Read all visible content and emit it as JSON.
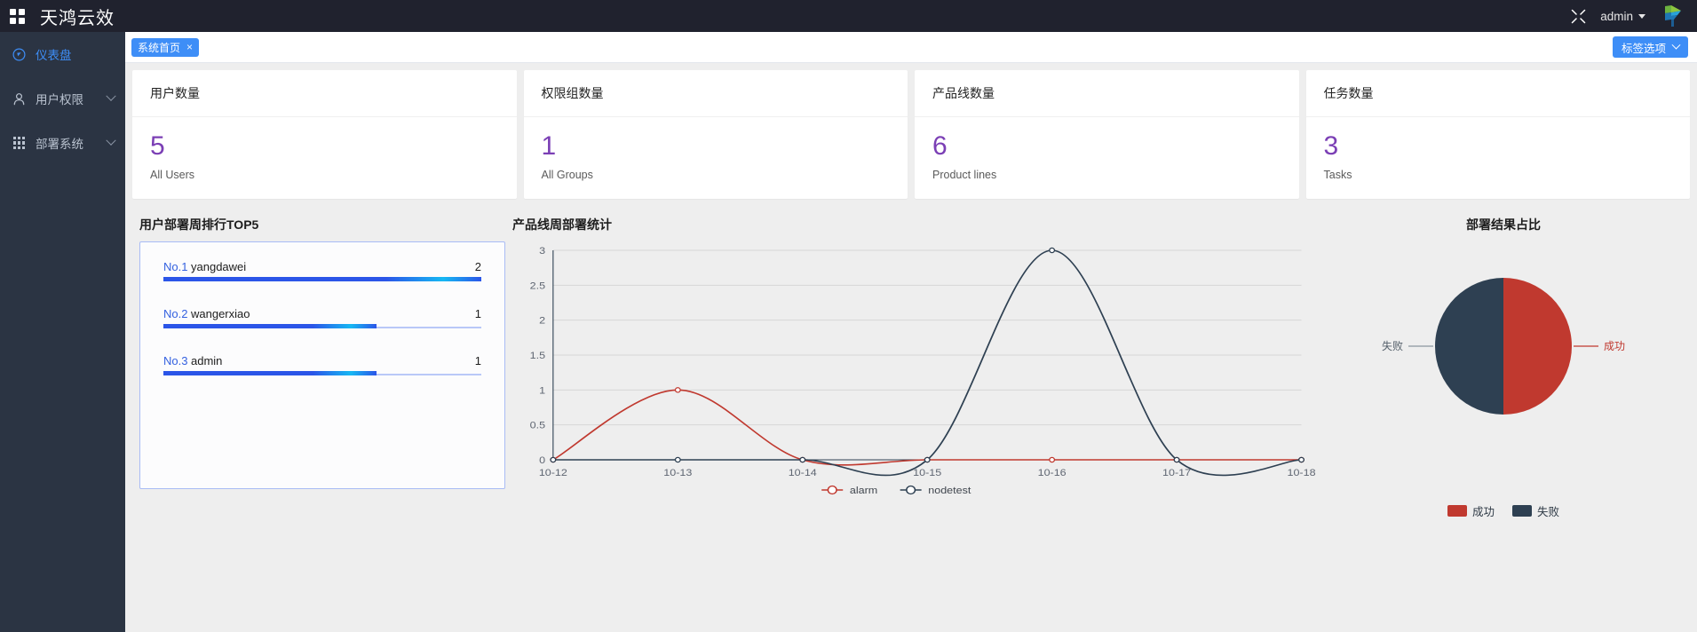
{
  "header": {
    "brand": "天鸿云效",
    "grid_icon": "grid-icon",
    "fullscreen_icon": "fullscreen-icon",
    "user": "admin",
    "logo_icon": "brand-logo-icon"
  },
  "sidebar": {
    "items": [
      {
        "label": "仪表盘",
        "icon": "dashboard-icon",
        "active": true,
        "expandable": false
      },
      {
        "label": "用户权限",
        "icon": "user-icon",
        "active": false,
        "expandable": true
      },
      {
        "label": "部署系统",
        "icon": "apps-grid-icon",
        "active": false,
        "expandable": true
      }
    ]
  },
  "tabbar": {
    "tabs": [
      {
        "label": "系统首页",
        "close": "×"
      }
    ],
    "tag_options_label": "标签选项"
  },
  "cards": [
    {
      "title": "用户数量",
      "value": "5",
      "subtitle": "All Users"
    },
    {
      "title": "权限组数量",
      "value": "1",
      "subtitle": "All Groups"
    },
    {
      "title": "产品线数量",
      "value": "6",
      "subtitle": "Product lines"
    },
    {
      "title": "任务数量",
      "value": "3",
      "subtitle": "Tasks"
    }
  ],
  "rank_panel": {
    "title": "用户部署周排行TOP5",
    "rows": [
      {
        "rank": "No.1",
        "name": "yangdawei",
        "value": "2",
        "pct": 100
      },
      {
        "rank": "No.2",
        "name": "wangerxiao",
        "value": "1",
        "pct": 67
      },
      {
        "rank": "No.3",
        "name": "admin",
        "value": "1",
        "pct": 67
      }
    ]
  },
  "colors": {
    "accent": "#3e8ef7",
    "rank_bar": "#2b55e8",
    "stat_number": "#7b3fb5",
    "series_alarm": "#c0392f",
    "series_nodetest": "#2e4052",
    "pie_success": "#c0392f",
    "pie_fail": "#2e4052",
    "sidebar_bg": "#2b3443",
    "header_bg": "#20222e"
  },
  "chart_data": [
    {
      "type": "line",
      "title": "产品线周部署统计",
      "xlabel": "",
      "ylabel": "",
      "x": [
        "10-12",
        "10-13",
        "10-14",
        "10-15",
        "10-16",
        "10-17",
        "10-18"
      ],
      "ylim": [
        0,
        3
      ],
      "yticks": [
        "0",
        "0.5",
        "1",
        "1.5",
        "2",
        "2.5",
        "3"
      ],
      "grid": true,
      "smooth": true,
      "legend_position": "bottom-center",
      "series": [
        {
          "name": "alarm",
          "color": "#c0392f",
          "values": [
            0,
            1,
            0,
            0,
            0,
            0,
            0
          ]
        },
        {
          "name": "nodetest",
          "color": "#2e4052",
          "values": [
            0,
            0,
            0,
            0,
            3,
            0,
            0
          ]
        }
      ]
    },
    {
      "type": "pie",
      "title": "部署结果占比",
      "labels": [
        "成功",
        "失败"
      ],
      "values": [
        50,
        50
      ],
      "colors": [
        "#c0392f",
        "#2e4052"
      ],
      "callouts": [
        {
          "label": "成功",
          "side": "right",
          "color": "#c0392f"
        },
        {
          "label": "失败",
          "side": "left",
          "color": "#55606b"
        }
      ],
      "legend": [
        {
          "label": "成功",
          "color": "#c0392f"
        },
        {
          "label": "失败",
          "color": "#2e4052"
        }
      ],
      "legend_position": "bottom"
    }
  ]
}
